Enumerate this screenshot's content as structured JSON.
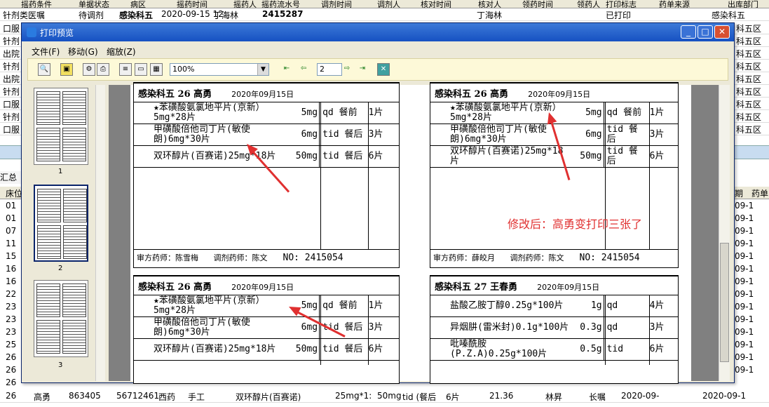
{
  "background": {
    "header_cols": [
      "摇药条件",
      "单据状态",
      "病区",
      "摇药时间",
      "摇药人",
      "摇药流水号",
      "调剂时间",
      "调剂人",
      "核对时间",
      "核对人",
      "领药时间",
      "领药人",
      "打印标志",
      "药单来源",
      "出库部门"
    ],
    "first_row": [
      "针剂类医嘱",
      "待调剂",
      "感染科五",
      "2020-09-15 12:",
      "丁海林",
      "2415287",
      "",
      "",
      "",
      "丁海林",
      "",
      "",
      "已打印",
      "",
      "感染科五"
    ],
    "left_rows": [
      "口服",
      "针剂",
      "出院",
      "针剂",
      "出院",
      "针剂",
      "口服",
      "针剂",
      "口服"
    ],
    "right_col": [
      "科五区",
      "科五区",
      "科五区",
      "科五区",
      "科五区",
      "科五区",
      "科五区",
      "科五区",
      "科五区"
    ],
    "summary_label": "汇总",
    "bed_header": "床位",
    "bed_col": [
      "01",
      "01",
      "07",
      "11",
      "15",
      "16",
      "16",
      "22",
      "23",
      "23",
      "23",
      "25",
      "26",
      "26",
      "26"
    ],
    "right_header": [
      "期",
      "药单"
    ],
    "right_dates": [
      "09-1",
      "09-1",
      "09-1",
      "09-1",
      "09-1",
      "09-1",
      "09-1",
      "09-1",
      "09-1",
      "09-1",
      "09-1",
      "09-1",
      "09-1",
      "09-1"
    ],
    "bottom_rows": [
      [
        "26",
        "高勇",
        "863405",
        "56712461",
        "西药",
        "手工",
        "双环醇片(百赛诺)",
        "25mg*1:",
        "50mg",
        "tid (餐后",
        "6片",
        "21.36",
        "林昇",
        "长嘱",
        "2020-09-",
        "2020-09-1"
      ]
    ]
  },
  "window": {
    "title": "打印预览",
    "menu": [
      "文件(F)",
      "移动(G)",
      "缩放(Z)"
    ],
    "zoom_value": "100%",
    "page_number": "2",
    "thumb_labels": [
      "1",
      "2",
      "3"
    ]
  },
  "labels": [
    {
      "dept": "感染科五",
      "bed": "26",
      "name": "高勇",
      "date": "2020年09月15日",
      "rows": [
        {
          "drug": "★苯磺酸氨氯地平片(京新）5mg*28片",
          "dose": "5mg",
          "freq": "qd 餐前",
          "qty": "1片"
        },
        {
          "drug": "甲磺酸倍他司丁片(敏使朗)6mg*30片",
          "dose": "6mg",
          "freq": "tid 餐后",
          "qty": "3片"
        },
        {
          "drug": "双环醇片(百赛诺)25mg*18片",
          "dose": "50mg",
          "freq": "tid 餐后",
          "qty": "6片"
        }
      ],
      "reviewer": "审方药师：陈雪梅",
      "dispenser": "调剂药师：陈文",
      "no": "NO: 2415054"
    },
    {
      "dept": "感染科五",
      "bed": "26",
      "name": "高勇",
      "date": "2020年09月15日",
      "rows": [
        {
          "drug": "★苯磺酸氨氯地平片(京新）5mg*28片",
          "dose": "5mg",
          "freq": "qd 餐前",
          "qty": "1片"
        },
        {
          "drug": "甲磺酸倍他司丁片(敏使朗)6mg*30片",
          "dose": "6mg",
          "freq": "tid 餐后",
          "qty": "3片"
        },
        {
          "drug": "双环醇片(百赛诺)25mg*18片",
          "dose": "50mg",
          "freq": "tid 餐后",
          "qty": "6片"
        }
      ],
      "reviewer": "审方药师：薛皎月",
      "dispenser": "调剂药师：陈文",
      "no": "NO: 2415054"
    },
    {
      "dept": "感染科五",
      "bed": "26",
      "name": "高勇",
      "date": "2020年09月15日",
      "rows": [
        {
          "drug": "★苯磺酸氨氯地平片(京新）5mg*28片",
          "dose": "5mg",
          "freq": "qd 餐前",
          "qty": "1片"
        },
        {
          "drug": "甲磺酸倍他司丁片(敏使朗)6mg*30片",
          "dose": "6mg",
          "freq": "tid 餐后",
          "qty": "3片"
        },
        {
          "drug": "双环醇片(百赛诺)25mg*18片",
          "dose": "50mg",
          "freq": "tid 餐后",
          "qty": "6片"
        }
      ]
    },
    {
      "dept": "感染科五",
      "bed": "27",
      "name": "王春勇",
      "date": "2020年09月15日",
      "rows": [
        {
          "drug": "盐酸乙胺丁醇0.25g*100片",
          "dose": "1g",
          "freq": "qd",
          "qty": "4片"
        },
        {
          "drug": "异烟肼(雷米封)0.1g*100片",
          "dose": "0.3g",
          "freq": "qd",
          "qty": "3片"
        },
        {
          "drug": "吡嗪酰胺(P.Z.A)0.25g*100片",
          "dose": "0.5g",
          "freq": "tid",
          "qty": "6片"
        }
      ]
    }
  ],
  "annotation": "修改后：高勇变打印三张了",
  "colors": {
    "annotation": "#e03030",
    "titlebar": "#1651c2"
  }
}
